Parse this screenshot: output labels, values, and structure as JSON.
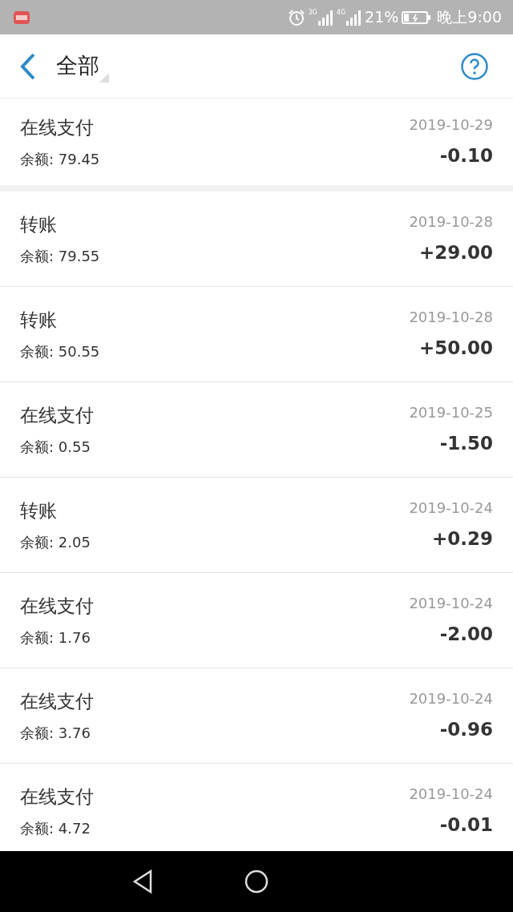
{
  "status_bar": {
    "battery_percent": "21%",
    "time": "晚上9:00",
    "network_1": "3G",
    "network_2": "4G"
  },
  "header": {
    "title": "全部"
  },
  "transactions": [
    {
      "type": "在线支付",
      "balance": "余额: 79.45",
      "date": "2019-10-29",
      "amount": "-0.10"
    },
    {
      "type": "转账",
      "balance": "余额: 79.55",
      "date": "2019-10-28",
      "amount": "+29.00"
    },
    {
      "type": "转账",
      "balance": "余额: 50.55",
      "date": "2019-10-28",
      "amount": "+50.00"
    },
    {
      "type": "在线支付",
      "balance": "余额: 0.55",
      "date": "2019-10-25",
      "amount": "-1.50"
    },
    {
      "type": "转账",
      "balance": "余额: 2.05",
      "date": "2019-10-24",
      "amount": "+0.29"
    },
    {
      "type": "在线支付",
      "balance": "余额: 1.76",
      "date": "2019-10-24",
      "amount": "-2.00"
    },
    {
      "type": "在线支付",
      "balance": "余额: 3.76",
      "date": "2019-10-24",
      "amount": "-0.96"
    },
    {
      "type": "在线支付",
      "balance": "余额: 4.72",
      "date": "2019-10-24",
      "amount": "-0.01"
    }
  ]
}
